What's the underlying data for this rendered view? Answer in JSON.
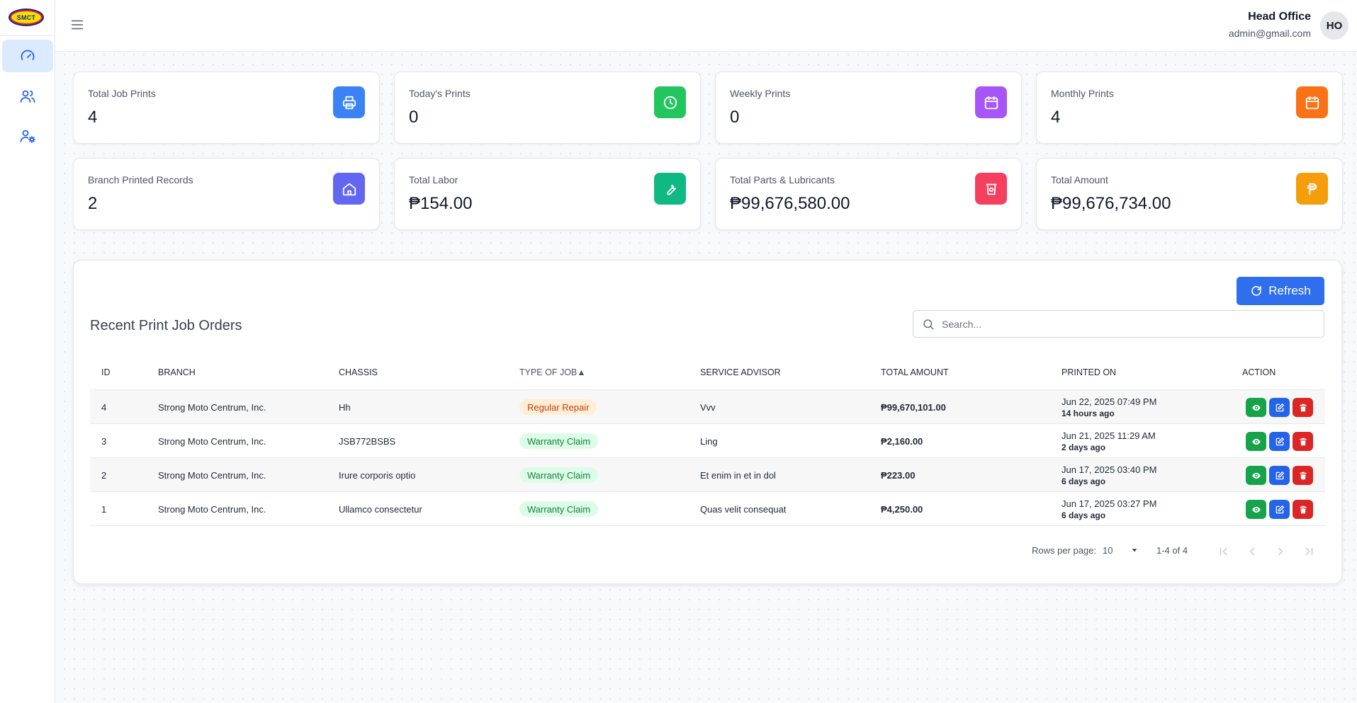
{
  "brand": {
    "logo_text": "SMCT"
  },
  "sidebar": {
    "items": [
      {
        "name": "dashboard",
        "icon": "gauge-icon",
        "active": true
      },
      {
        "name": "users",
        "icon": "users-icon",
        "active": false
      },
      {
        "name": "user-settings",
        "icon": "user-gear-icon",
        "active": false
      }
    ]
  },
  "header": {
    "menu_icon": "hamburger-icon",
    "user_name": "Head Office",
    "user_email": "admin@gmail.com",
    "avatar_initials": "HO"
  },
  "stats": [
    {
      "label": "Total Job Prints",
      "value": "4",
      "icon": "printer-icon",
      "color": "#3b82f6"
    },
    {
      "label": "Today's Prints",
      "value": "0",
      "icon": "clock-icon",
      "color": "#22c55e"
    },
    {
      "label": "Weekly Prints",
      "value": "0",
      "icon": "calendar-icon",
      "color": "#a855f7"
    },
    {
      "label": "Monthly Prints",
      "value": "4",
      "icon": "calendar-icon",
      "color": "#f97316"
    },
    {
      "label": "Branch Printed Records",
      "value": "2",
      "icon": "home-icon",
      "color": "#6366f1"
    },
    {
      "label": "Total Labor",
      "value": "₱154.00",
      "icon": "wrench-icon",
      "color": "#10b981"
    },
    {
      "label": "Total Parts & Lubricants",
      "value": "₱99,676,580.00",
      "icon": "bin-icon",
      "color": "#f43f5e"
    },
    {
      "label": "Total Amount",
      "value": "₱99,676,734.00",
      "icon": "peso-icon",
      "color": "#f59e0b"
    }
  ],
  "panel": {
    "title": "Recent Print Job Orders",
    "refresh_label": "Refresh",
    "search_placeholder": "Search...",
    "columns": [
      "ID",
      "BRANCH",
      "CHASSIS",
      "TYPE OF JOB",
      "SERVICE ADVISOR",
      "TOTAL AMOUNT",
      "PRINTED ON",
      "ACTION"
    ],
    "sort_indicator": "▲",
    "rows": [
      {
        "id": "4",
        "branch": "Strong Moto Centrum, Inc.",
        "chassis": "Hh",
        "type": "Regular Repair",
        "type_kind": "regular",
        "advisor": "Vvv",
        "amount": "₱99,670,101.00",
        "printed_date": "Jun 22, 2025 07:49 PM",
        "printed_ago": "14 hours ago"
      },
      {
        "id": "3",
        "branch": "Strong Moto Centrum, Inc.",
        "chassis": "JSB772BSBS",
        "type": "Warranty Claim",
        "type_kind": "warranty",
        "advisor": "Ling",
        "amount": "₱2,160.00",
        "printed_date": "Jun 21, 2025 11:29 AM",
        "printed_ago": "2 days ago"
      },
      {
        "id": "2",
        "branch": "Strong Moto Centrum, Inc.",
        "chassis": "Irure corporis optio",
        "type": "Warranty Claim",
        "type_kind": "warranty",
        "advisor": "Et enim in et in dol",
        "amount": "₱223.00",
        "printed_date": "Jun 17, 2025 03:40 PM",
        "printed_ago": "6 days ago"
      },
      {
        "id": "1",
        "branch": "Strong Moto Centrum, Inc.",
        "chassis": "Ullamco consectetur",
        "type": "Warranty Claim",
        "type_kind": "warranty",
        "advisor": "Quas velit consequat",
        "amount": "₱4,250.00",
        "printed_date": "Jun 17, 2025 03:27 PM",
        "printed_ago": "6 days ago"
      }
    ],
    "actions": [
      {
        "name": "view",
        "icon": "eye-icon",
        "color": "#16a34a"
      },
      {
        "name": "edit",
        "icon": "edit-icon",
        "color": "#2563eb"
      },
      {
        "name": "delete",
        "icon": "trash-icon",
        "color": "#dc2626"
      }
    ],
    "pagination": {
      "rows_per_page_label": "Rows per page:",
      "rows_per_page": "10",
      "range": "1-4 of 4"
    }
  }
}
